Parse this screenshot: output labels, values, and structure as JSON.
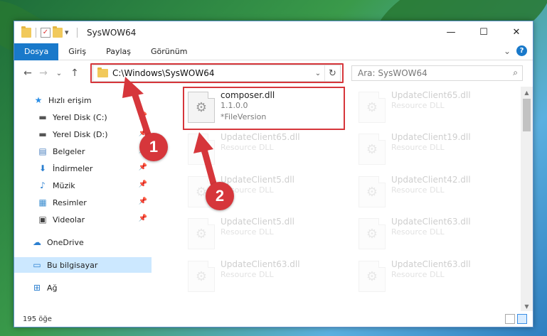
{
  "window": {
    "title": "SysWOW64",
    "minimize": "—",
    "maximize": "☐",
    "close": "✕"
  },
  "ribbon": {
    "tabs": [
      "Dosya",
      "Giriş",
      "Paylaş",
      "Görünüm"
    ],
    "expand": "⌄",
    "help": "?"
  },
  "nav": {
    "back": "←",
    "forward": "→",
    "recent": "⌄",
    "up": "↑",
    "address": "C:\\Windows\\SysWOW64",
    "dropdown": "⌄",
    "refresh": "↻",
    "search_placeholder": "Ara: SysWOW64",
    "search_icon": "⌕"
  },
  "sidebar": {
    "items": [
      {
        "label": "Hızlı erişim",
        "icon": "star-icon",
        "glyph": "★",
        "color": "#2b8ee6"
      },
      {
        "label": "Yerel Disk (C:)",
        "icon": "drive-icon",
        "glyph": "▬",
        "color": "#555"
      },
      {
        "label": "Yerel Disk (D:)",
        "icon": "drive-icon",
        "glyph": "▬",
        "color": "#555"
      },
      {
        "label": "Belgeler",
        "icon": "document-icon",
        "glyph": "▤",
        "color": "#4a7fbf"
      },
      {
        "label": "İndirmeler",
        "icon": "download-icon",
        "glyph": "⬇",
        "color": "#2b7fd0"
      },
      {
        "label": "Müzik",
        "icon": "music-icon",
        "glyph": "♪",
        "color": "#2b7fd0"
      },
      {
        "label": "Resimler",
        "icon": "picture-icon",
        "glyph": "▦",
        "color": "#3c8ed0"
      },
      {
        "label": "Videolar",
        "icon": "video-icon",
        "glyph": "▣",
        "color": "#444"
      },
      {
        "label": "OneDrive",
        "icon": "cloud-icon",
        "glyph": "☁",
        "color": "#2b7fd0"
      },
      {
        "label": "Bu bilgisayar",
        "icon": "computer-icon",
        "glyph": "▭",
        "color": "#2b7fd0"
      },
      {
        "label": "Ağ",
        "icon": "network-icon",
        "glyph": "⊞",
        "color": "#2b7fd0"
      }
    ],
    "pin": "📌"
  },
  "files": {
    "highlighted": {
      "name": "composer.dll",
      "version": "1.1.0.0",
      "desc": "*FileVersion"
    },
    "faded": [
      {
        "name": "UpdateClient65.dll",
        "desc": "Resource DLL"
      },
      {
        "name": "UpdateClient65.dll",
        "desc": "Resource DLL"
      },
      {
        "name": "UpdateClient19.dll",
        "desc": "Resource DLL"
      },
      {
        "name": "UpdateClient5.dll",
        "desc": "Resource DLL"
      },
      {
        "name": "UpdateClient42.dll",
        "desc": "Resource DLL"
      },
      {
        "name": "UpdateClient5.dll",
        "desc": "Resource DLL"
      },
      {
        "name": "UpdateClient63.dll",
        "desc": "Resource DLL"
      },
      {
        "name": "UpdateClient63.dll",
        "desc": "Resource DLL"
      },
      {
        "name": "UpdateClient63.dll",
        "desc": "Resource DLL"
      }
    ]
  },
  "status": {
    "count": "195 öğe"
  },
  "annotations": {
    "step1": "1",
    "step2": "2",
    "color": "#d6363b"
  }
}
